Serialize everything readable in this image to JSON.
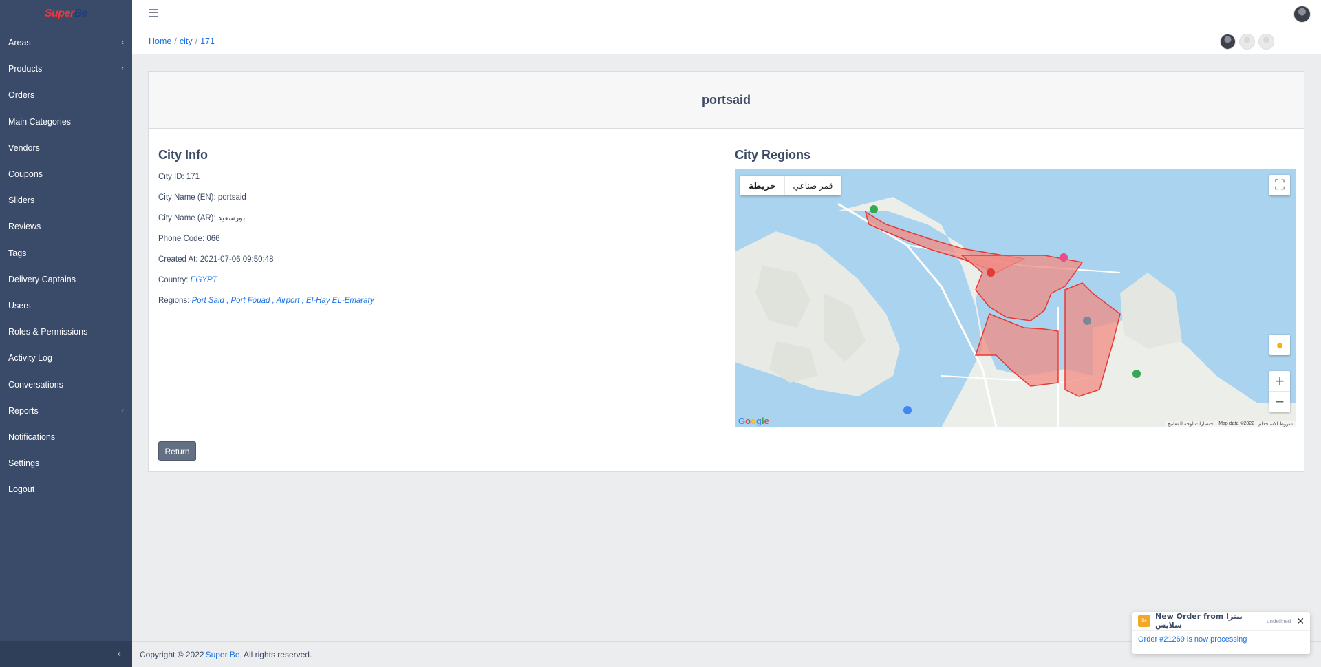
{
  "brand": {
    "name_red": "Super",
    "name_blue": "Be"
  },
  "sidebar": {
    "items": [
      {
        "label": "Areas",
        "chevron": true
      },
      {
        "label": "Products",
        "chevron": true
      },
      {
        "label": "Orders",
        "chevron": false
      },
      {
        "label": "Main Categories",
        "chevron": false
      },
      {
        "label": "Vendors",
        "chevron": false
      },
      {
        "label": "Coupons",
        "chevron": false
      },
      {
        "label": "Sliders",
        "chevron": false
      },
      {
        "label": "Reviews",
        "chevron": false
      },
      {
        "label": "Tags",
        "chevron": false
      },
      {
        "label": "Delivery Captains",
        "chevron": false
      },
      {
        "label": "Users",
        "chevron": false
      },
      {
        "label": "Roles & Permissions",
        "chevron": false
      },
      {
        "label": "Activity Log",
        "chevron": false
      },
      {
        "label": "Conversations",
        "chevron": false
      },
      {
        "label": "Reports",
        "chevron": true
      },
      {
        "label": "Notifications",
        "chevron": false
      },
      {
        "label": "Settings",
        "chevron": false
      },
      {
        "label": "Logout",
        "chevron": false
      }
    ],
    "chevron_glyph": "‹",
    "toggle_glyph": "‹"
  },
  "breadcrumb": {
    "home": "Home",
    "city": "city",
    "id": "171",
    "sep": "/"
  },
  "card": {
    "title": "portsaid",
    "info": {
      "heading": "City Info",
      "city_id": "City ID: 171",
      "name_en": "City Name (EN): portsaid",
      "name_ar": "City Name (AR): بورسعيد",
      "phone_code": "Phone Code: 066",
      "created_at": "Created At: 2021-07-06 09:50:48",
      "country_label": "Country:",
      "country": "EGYPT",
      "regions_label": "Regions:",
      "regions": [
        "Port Said",
        "Port Fouad",
        "Airport",
        "El-Hay EL-Emaraty"
      ],
      "regions_sep": " , "
    },
    "regions": {
      "heading": "City Regions",
      "map_type_map": "خريطة",
      "map_type_satellite": "قمر صناعي",
      "google": "Google",
      "attrib_terms": "شروط الاستخدام",
      "attrib_data": "Map data ©2022",
      "attrib_shortcuts": "اختصارات لوحة المفاتيح",
      "zoom_in": "+",
      "zoom_out": "−"
    },
    "return_label": "Return"
  },
  "footer": {
    "prefix": "Copyright © 2022",
    "brand": "Super Be,",
    "suffix": "All rights reserved."
  },
  "toast": {
    "logo": "Be",
    "title": "New Order from بيتزا سلايس",
    "time": "undefined",
    "close": "✕",
    "body": "Order #21269 is now processing"
  },
  "colors": {
    "sidebar": "#3a4b6a",
    "link": "#1a73e8",
    "region_fill": "#f28b82",
    "region_stroke": "#e53935",
    "water": "#a9d3ee"
  }
}
